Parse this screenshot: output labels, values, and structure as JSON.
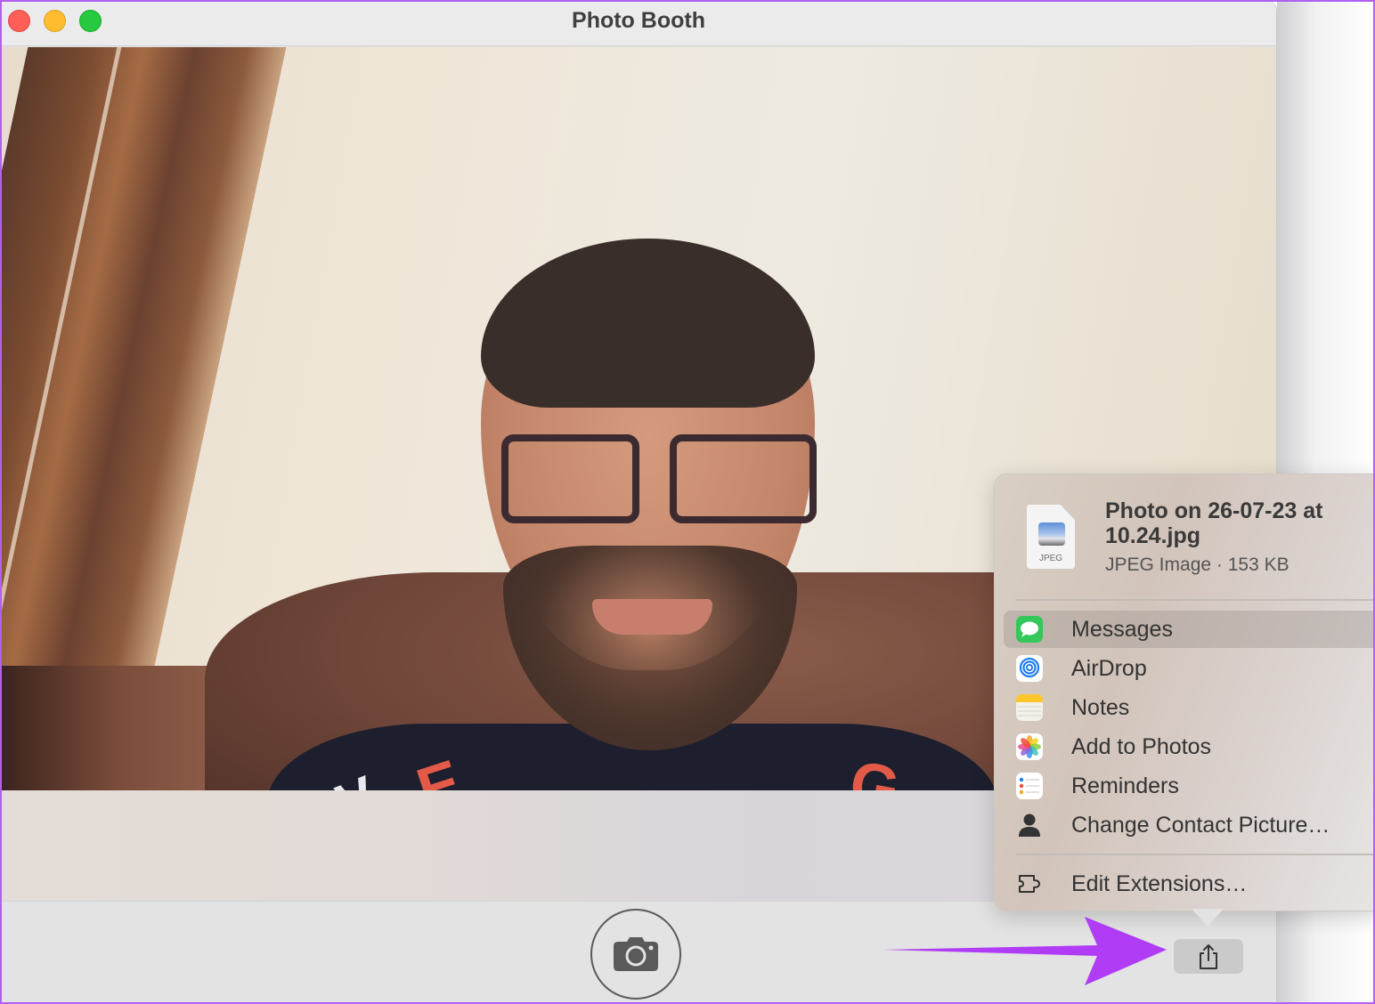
{
  "window": {
    "title": "Photo Booth",
    "controls": [
      "close",
      "minimize",
      "zoom"
    ]
  },
  "preview": {
    "description": "Live camera preview of a smiling man with glasses and beard seated on a brown sofa",
    "sweater_letters": [
      "V",
      "E",
      "G"
    ]
  },
  "toolbar": {
    "shutter_icon": "camera-icon",
    "share_icon": "share-icon"
  },
  "share_menu": {
    "file": {
      "icon_label": "JPEG",
      "name": "Photo on 26-07-23 at 10.24.jpg",
      "meta": "JPEG Image · 153 KB"
    },
    "items": [
      {
        "label": "Messages",
        "icon": "messages-icon",
        "selected": true
      },
      {
        "label": "AirDrop",
        "icon": "airdrop-icon"
      },
      {
        "label": "Notes",
        "icon": "notes-icon"
      },
      {
        "label": "Add to Photos",
        "icon": "photos-icon"
      },
      {
        "label": "Reminders",
        "icon": "reminders-icon"
      },
      {
        "label": "Change Contact Picture…",
        "icon": "person-icon"
      }
    ],
    "footer_item": {
      "label": "Edit Extensions…",
      "icon": "extensions-icon"
    }
  },
  "annotation": {
    "arrow_color": "#b03cf5",
    "points_to": "share-button"
  }
}
